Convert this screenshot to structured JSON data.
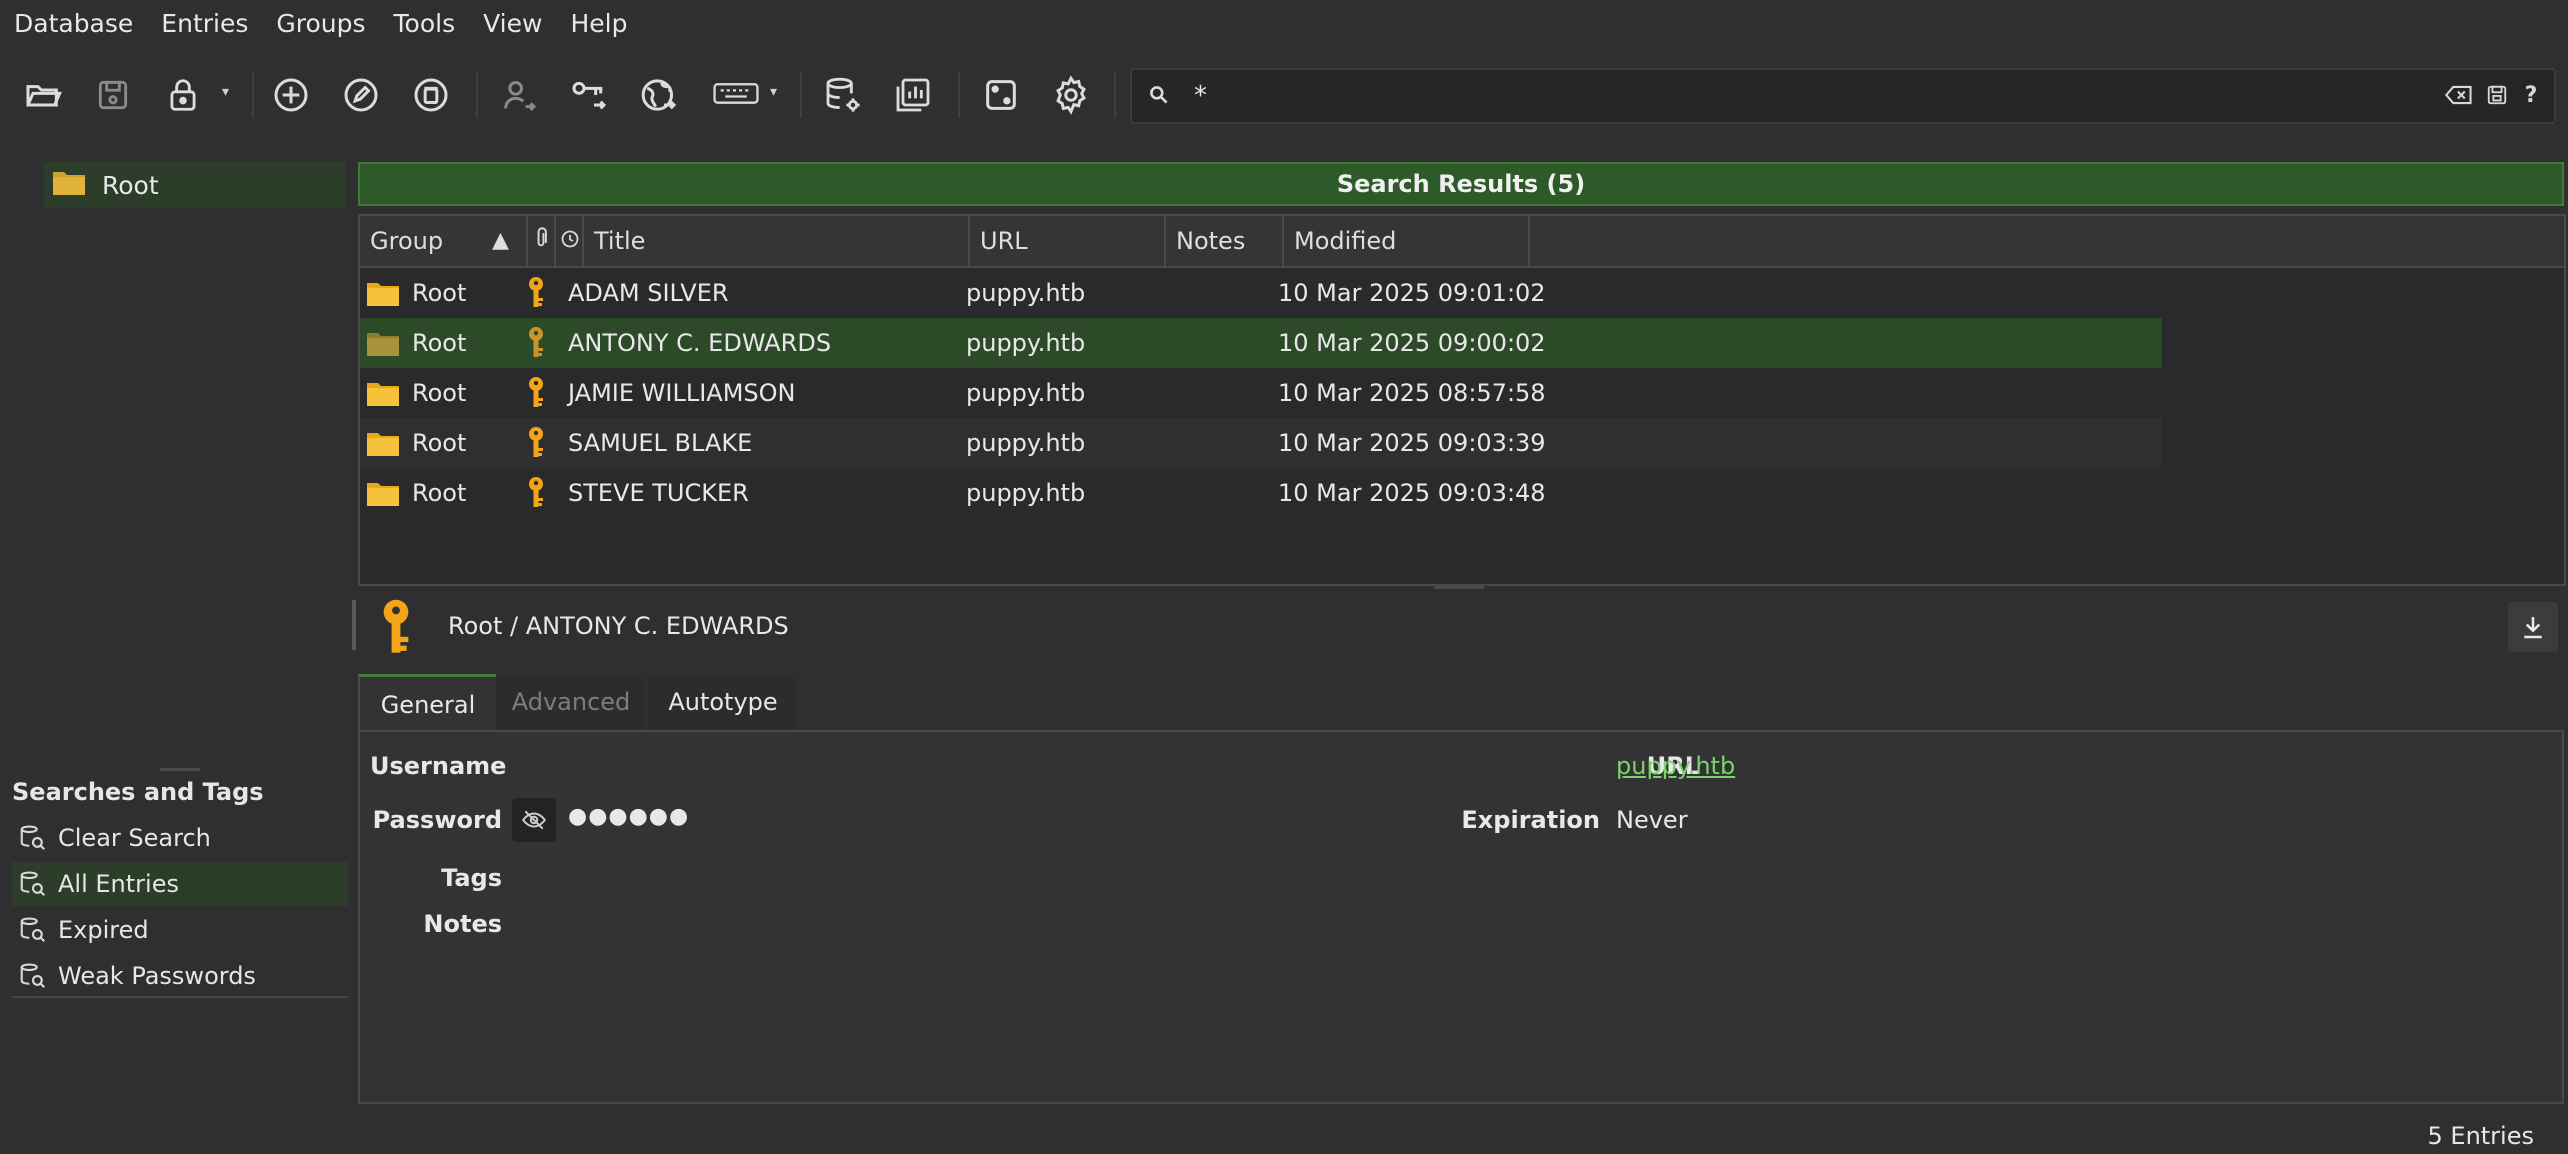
{
  "menubar": {
    "items": [
      "Database",
      "Entries",
      "Groups",
      "Tools",
      "View",
      "Help"
    ]
  },
  "toolbar": {
    "icons": [
      "open-database-icon",
      "save-database-icon",
      "lock-database-icon",
      "add-entry-icon",
      "edit-entry-icon",
      "delete-entry-icon",
      "copy-username-icon",
      "copy-password-icon",
      "open-url-icon",
      "autotype-keyboard-icon",
      "database-settings-icon",
      "database-reports-icon",
      "password-generator-icon",
      "settings-gear-icon"
    ]
  },
  "search": {
    "value": "*",
    "placeholder": ""
  },
  "groups": {
    "root_label": "Root"
  },
  "tags_pane": {
    "title": "Searches and Tags",
    "items": [
      {
        "label": "Clear Search"
      },
      {
        "label": "All Entries",
        "selected": true
      },
      {
        "label": "Expired"
      },
      {
        "label": "Weak Passwords"
      }
    ]
  },
  "results": {
    "header": "Search Results (5)",
    "columns": {
      "group": "Group",
      "title": "Title",
      "url": "URL",
      "notes": "Notes",
      "modified": "Modified"
    },
    "rows": [
      {
        "group": "Root",
        "title": "ADAM SILVER",
        "url": "puppy.htb",
        "notes": "",
        "modified": "10 Mar 2025 09:01:02"
      },
      {
        "group": "Root",
        "title": "ANTONY C. EDWARDS",
        "url": "puppy.htb",
        "notes": "",
        "modified": "10 Mar 2025 09:00:02",
        "selected": true
      },
      {
        "group": "Root",
        "title": "JAMIE WILLIAMSON",
        "url": "puppy.htb",
        "notes": "",
        "modified": "10 Mar 2025 08:57:58"
      },
      {
        "group": "Root",
        "title": "SAMUEL BLAKE",
        "url": "puppy.htb",
        "notes": "",
        "modified": "10 Mar 2025 09:03:39"
      },
      {
        "group": "Root",
        "title": "STEVE TUCKER",
        "url": "puppy.htb",
        "notes": "",
        "modified": "10 Mar 2025 09:03:48"
      }
    ]
  },
  "preview": {
    "path": "Root / ANTONY C. EDWARDS",
    "tabs": {
      "general": "General",
      "advanced": "Advanced",
      "autotype": "Autotype"
    },
    "labels": {
      "username": "Username",
      "password": "Password",
      "tags": "Tags",
      "notes": "Notes",
      "url": "URL",
      "expiration": "Expiration"
    },
    "values": {
      "username": "",
      "password": "●●●●●●",
      "url": "puppy.htb",
      "expiration": "Never"
    }
  },
  "status": {
    "entries": "5 Entries"
  },
  "colors": {
    "selection": "#2c4a28",
    "results_header": "#2e5a2a",
    "folder": "#f6c23a",
    "key": "#f2a516",
    "link": "#7bd36a"
  }
}
